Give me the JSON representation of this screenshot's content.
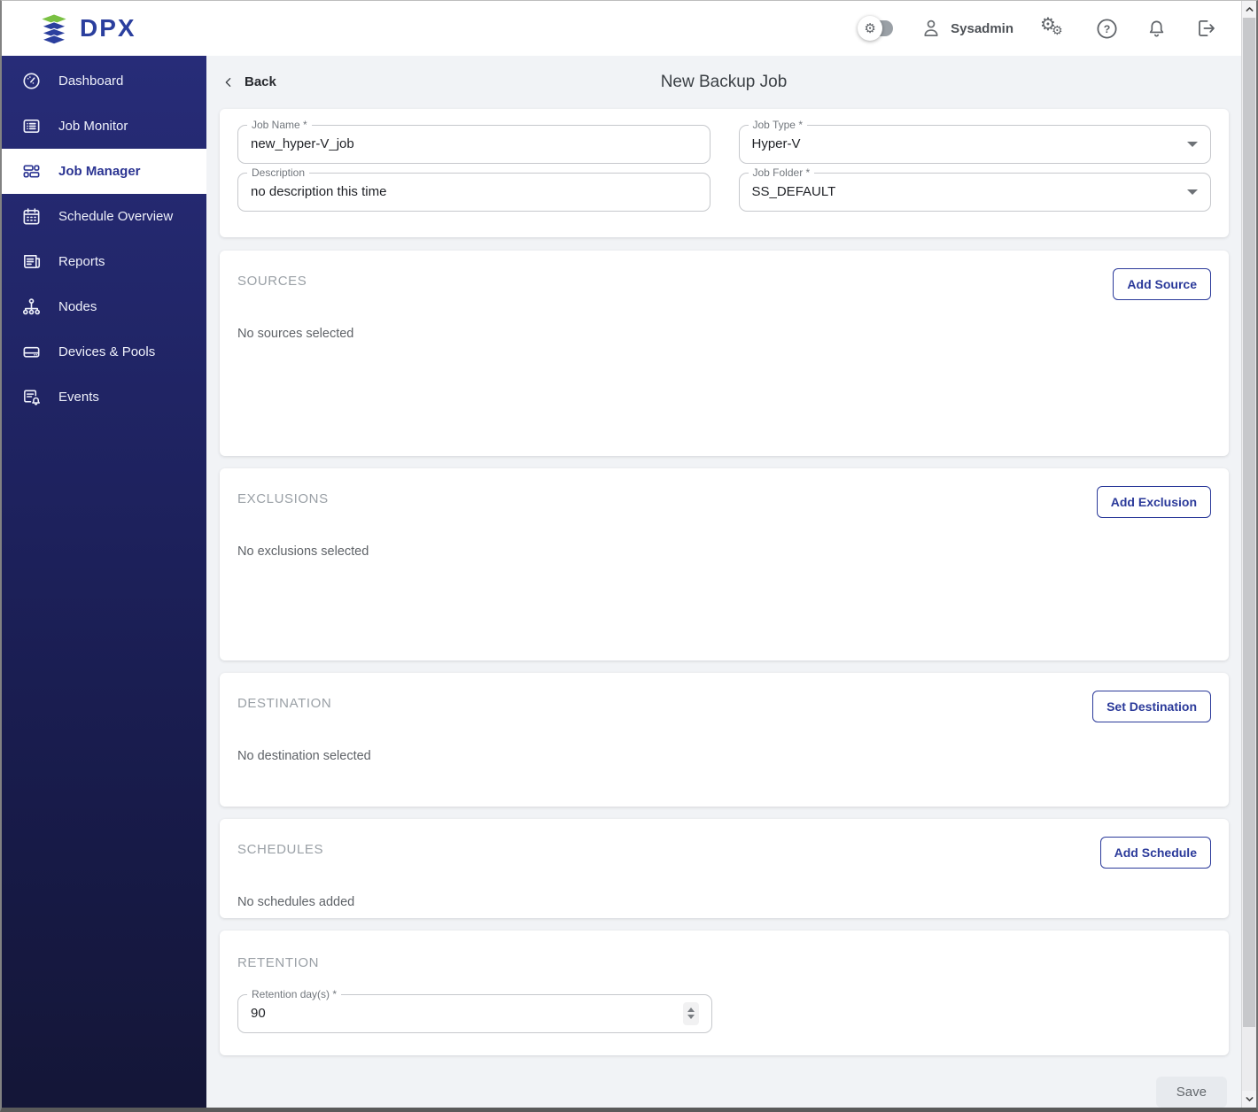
{
  "brand": {
    "logo_text": "DPX"
  },
  "header": {
    "user_name": "Sysadmin"
  },
  "sidebar": {
    "items": [
      {
        "label": "Dashboard"
      },
      {
        "label": "Job Monitor"
      },
      {
        "label": "Job Manager"
      },
      {
        "label": "Schedule Overview"
      },
      {
        "label": "Reports"
      },
      {
        "label": "Nodes"
      },
      {
        "label": "Devices & Pools"
      },
      {
        "label": "Events"
      }
    ]
  },
  "page": {
    "back_label": "Back",
    "title": "New Backup Job"
  },
  "form": {
    "job_name": {
      "label": "Job Name *",
      "value": "new_hyper-V_job"
    },
    "job_type": {
      "label": "Job Type *",
      "value": "Hyper-V"
    },
    "description": {
      "label": "Description",
      "value": "no description this time"
    },
    "job_folder": {
      "label": "Job Folder *",
      "value": "SS_DEFAULT"
    }
  },
  "sections": {
    "sources": {
      "title": "SOURCES",
      "button_label": "Add Source",
      "empty_text": "No sources selected"
    },
    "exclusions": {
      "title": "EXCLUSIONS",
      "button_label": "Add Exclusion",
      "empty_text": "No exclusions selected"
    },
    "destination": {
      "title": "DESTINATION",
      "button_label": "Set Destination",
      "empty_text": "No destination selected"
    },
    "schedules": {
      "title": "SCHEDULES",
      "button_label": "Add Schedule",
      "empty_text": "No schedules added"
    },
    "retention": {
      "title": "RETENTION",
      "field_label": "Retention day(s) *",
      "value": "90"
    }
  },
  "footer": {
    "save_label": "Save"
  },
  "colors": {
    "primary": "#2b3a9a",
    "sidebar_top": "#272c78",
    "sidebar_bottom": "#141637",
    "logo_green": "#7ac143",
    "logo_blue": "#2b3f9e"
  }
}
